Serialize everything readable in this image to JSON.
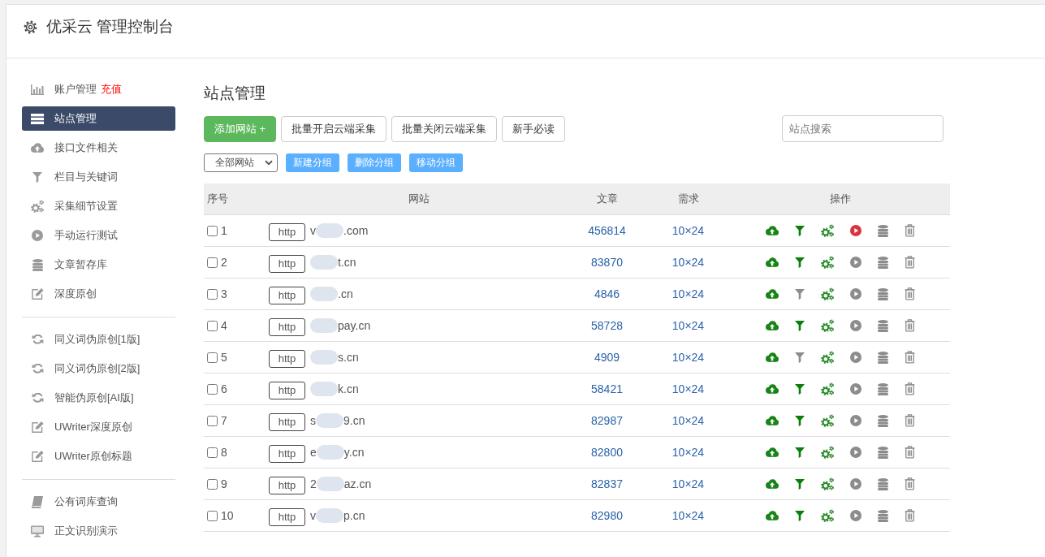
{
  "header": {
    "title": "优采云 管理控制台"
  },
  "sidebar": {
    "sections": [
      {
        "items": [
          {
            "label": "账户管理",
            "link": "充值",
            "selected": false
          },
          {
            "label": "站点管理",
            "selected": true
          },
          {
            "label": "接口文件相关",
            "selected": false
          },
          {
            "label": "栏目与关键词",
            "selected": false
          },
          {
            "label": "采集细节设置",
            "selected": false
          },
          {
            "label": "手动运行测试",
            "selected": false
          },
          {
            "label": "文章暂存库",
            "selected": false
          },
          {
            "label": "深度原创",
            "selected": false
          }
        ]
      },
      {
        "items": [
          {
            "label": "同义词伪原创[1版]",
            "selected": false
          },
          {
            "label": "同义词伪原创[2版]",
            "selected": false
          },
          {
            "label": "智能伪原创[AI版]",
            "selected": false
          },
          {
            "label": "UWriter深度原创",
            "selected": false
          },
          {
            "label": "UWriter原创标题",
            "selected": false
          }
        ]
      },
      {
        "items": [
          {
            "label": "公有词库查询",
            "selected": false
          },
          {
            "label": "正文识别演示",
            "selected": false
          }
        ]
      }
    ]
  },
  "main": {
    "title": "站点管理",
    "toolbar": {
      "buttons": [
        {
          "label": "添加网站 +",
          "kind": "primary"
        },
        {
          "label": "批量开启云端采集",
          "kind": "default"
        },
        {
          "label": "批量关闭云端采集",
          "kind": "default"
        },
        {
          "label": "新手必读",
          "kind": "default"
        }
      ],
      "search": {
        "placeholder": "站点搜索"
      }
    },
    "group_bar": {
      "select": {
        "value": "全部网站"
      },
      "buttons": [
        "新建分组",
        "删除分组",
        "移动分组"
      ]
    }
  },
  "table": {
    "columns": [
      "序号",
      "网站",
      "文章",
      "需求",
      "操作"
    ],
    "rows": [
      {
        "checked": false,
        "number": "1",
        "protocol": "http",
        "domain_head": "v",
        "domain_tail": ".com",
        "articles": "456814",
        "demand": "10×24",
        "filter_on": true,
        "running": true
      },
      {
        "checked": false,
        "number": "2",
        "protocol": "http",
        "domain_tail": "t.cn",
        "articles": "83870",
        "demand": "10×24",
        "filter_on": true,
        "running": false
      },
      {
        "checked": false,
        "number": "3",
        "protocol": "http",
        "domain_tail": ".cn",
        "articles": "4846",
        "demand": "10×24",
        "filter_on": false,
        "running": false
      },
      {
        "checked": false,
        "number": "4",
        "protocol": "http",
        "domain_tail": "pay.cn",
        "articles": "58728",
        "demand": "10×24",
        "filter_on": true,
        "running": false
      },
      {
        "checked": false,
        "number": "5",
        "protocol": "http",
        "domain_tail": "s.cn",
        "articles": "4909",
        "demand": "10×24",
        "filter_on": false,
        "running": false
      },
      {
        "checked": false,
        "number": "6",
        "protocol": "http",
        "domain_tail": "k.cn",
        "articles": "58421",
        "demand": "10×24",
        "filter_on": true,
        "running": false
      },
      {
        "checked": false,
        "number": "7",
        "protocol": "http",
        "domain_head": "s",
        "domain_tail": "9.cn",
        "articles": "82987",
        "demand": "10×24",
        "filter_on": true,
        "running": false
      },
      {
        "checked": false,
        "number": "8",
        "protocol": "http",
        "domain_head": "e",
        "domain_tail": "y.cn",
        "articles": "82800",
        "demand": "10×24",
        "filter_on": true,
        "running": false
      },
      {
        "checked": false,
        "number": "9",
        "protocol": "http",
        "domain_head": "2",
        "domain_tail": "az.cn",
        "articles": "82837",
        "demand": "10×24",
        "filter_on": true,
        "running": false
      },
      {
        "checked": false,
        "number": "10",
        "protocol": "http",
        "domain_head": "v",
        "domain_tail": "p.cn",
        "articles": "82980",
        "demand": "10×24",
        "filter_on": true,
        "running": false
      }
    ]
  }
}
